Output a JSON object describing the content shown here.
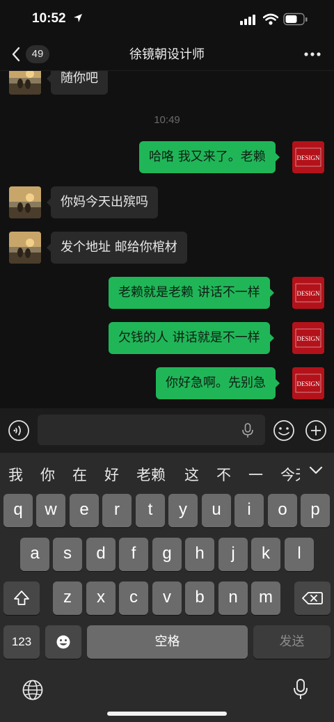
{
  "status_bar": {
    "time": "10:52"
  },
  "nav": {
    "back_count": "49",
    "title": "徐镜朝设计师"
  },
  "chat": {
    "messages": [
      {
        "side": "left",
        "text": "随你吧"
      },
      {
        "type": "time",
        "text": "10:49"
      },
      {
        "side": "right",
        "text": "哈咯 我又来了。老赖"
      },
      {
        "side": "left",
        "text": "你妈今天出殡吗"
      },
      {
        "side": "left",
        "text": "发个地址 邮给你棺材"
      },
      {
        "side": "right",
        "text": "老赖就是老赖 讲话不一样"
      },
      {
        "side": "right",
        "text": "欠钱的人 讲话就是不一样"
      },
      {
        "side": "right",
        "text": "你好急啊。先别急"
      }
    ],
    "avatar_right_text": "DESIGN"
  },
  "keyboard": {
    "candidates": [
      "我",
      "你",
      "在",
      "好",
      "老赖",
      "这",
      "不",
      "一",
      "今天"
    ],
    "row1": [
      "q",
      "w",
      "e",
      "r",
      "t",
      "y",
      "u",
      "i",
      "o",
      "p"
    ],
    "row2": [
      "a",
      "s",
      "d",
      "f",
      "g",
      "h",
      "j",
      "k",
      "l"
    ],
    "row3": [
      "z",
      "x",
      "c",
      "v",
      "b",
      "n",
      "m"
    ],
    "num_key": "123",
    "space_key": "空格",
    "send_key": "发送"
  },
  "colors": {
    "bubble_green": "#20b658",
    "bubble_dark": "#2a2a2a",
    "background": "#111111",
    "avatar_red": "#b3121a"
  }
}
